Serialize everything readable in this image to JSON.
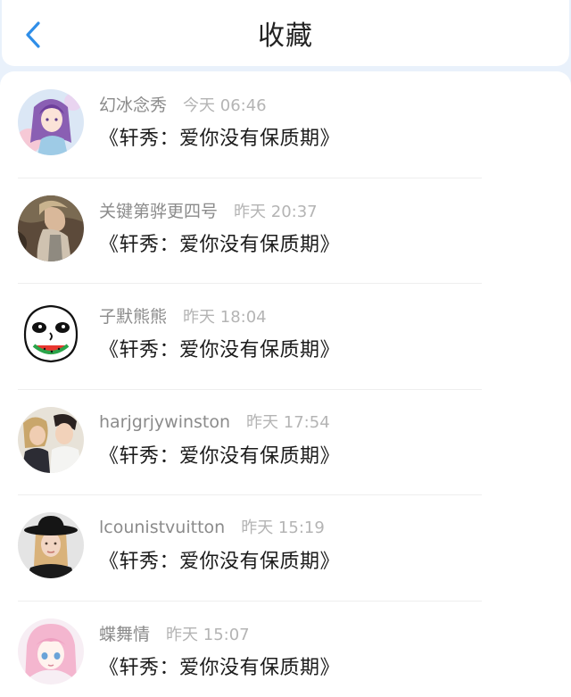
{
  "header": {
    "title": "收藏",
    "back_icon": "chevron-left-icon",
    "accent": "#2f8ee8"
  },
  "items": [
    {
      "name": "幻冰念秀",
      "time": "今天 06:46",
      "message": "《轩秀：爱你没有保质期》",
      "avatar": "anime-girl-purple-avatar"
    },
    {
      "name": "关键第骅更四号",
      "time": "昨天 20:37",
      "message": "《轩秀：爱你没有保质期》",
      "avatar": "woman-photo-avatar"
    },
    {
      "name": "子默熊熊",
      "time": "昨天 18:04",
      "message": "《轩秀：爱你没有保质期》",
      "avatar": "cartoon-face-watermelon-avatar"
    },
    {
      "name": "harjgrjywinston",
      "time": "昨天 17:54",
      "message": "《轩秀：爱你没有保质期》",
      "avatar": "couple-photo-avatar"
    },
    {
      "name": "lcounistvuitton",
      "time": "昨天 15:19",
      "message": "《轩秀：爱你没有保质期》",
      "avatar": "woman-black-hat-avatar"
    },
    {
      "name": "蝶舞情",
      "time": "昨天 15:07",
      "message": "《轩秀：爱你没有保质期》",
      "avatar": "anime-girl-pink-avatar"
    }
  ]
}
